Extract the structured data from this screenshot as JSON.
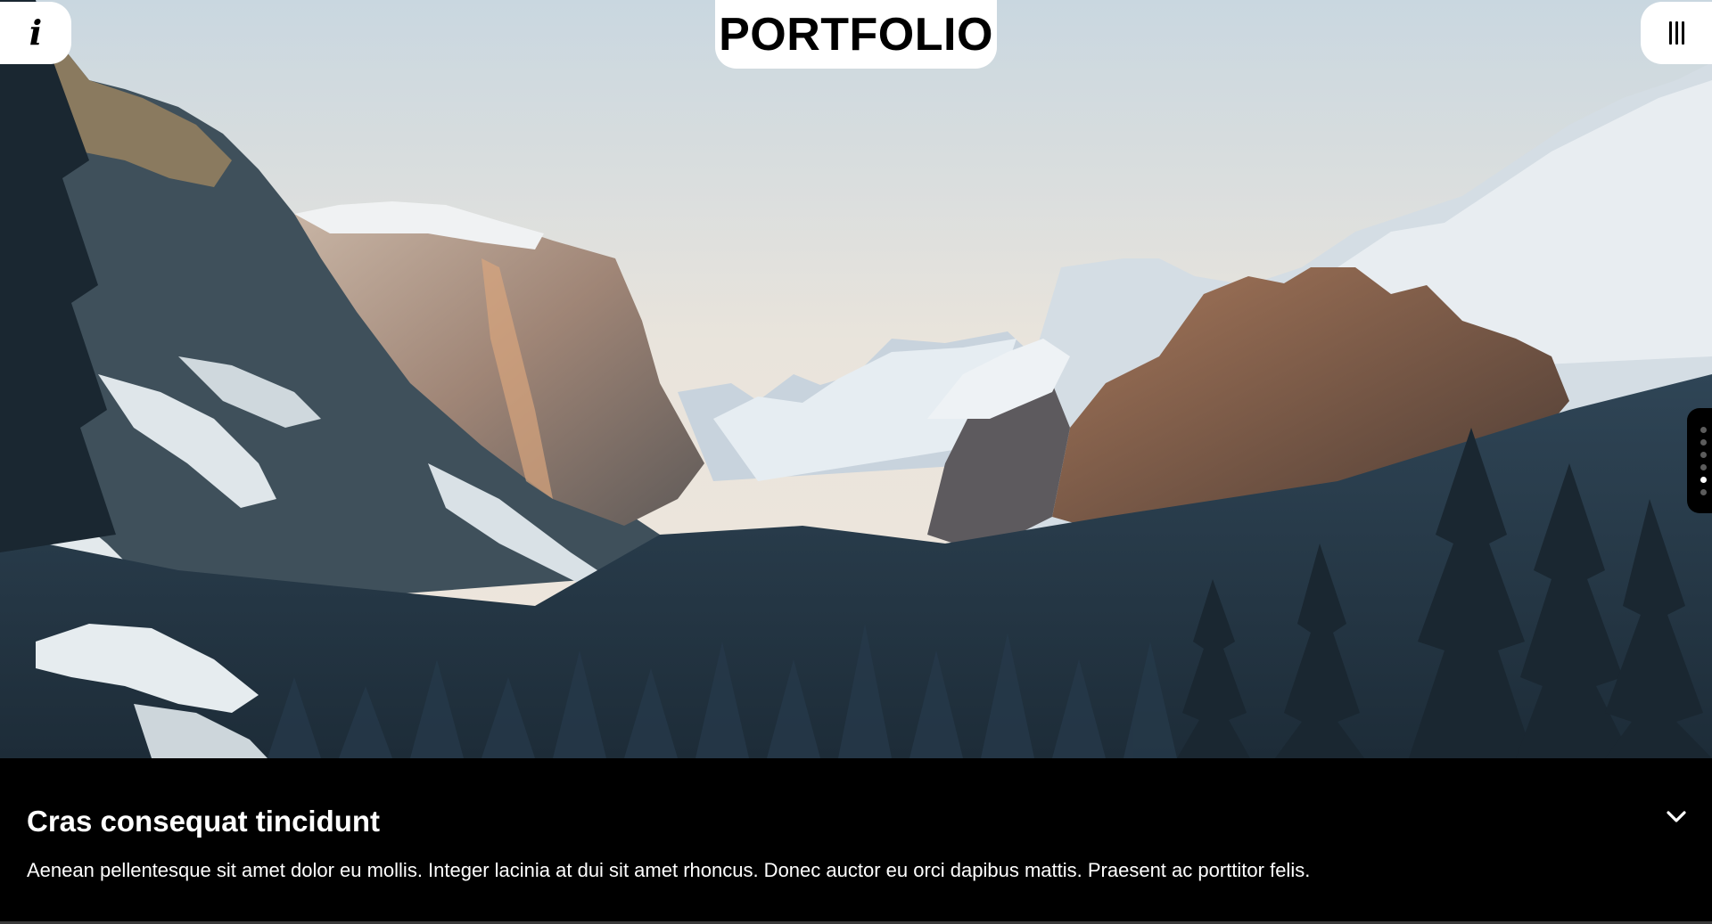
{
  "header": {
    "logo_text": "PORTFOLIO",
    "info_icon": "info-icon",
    "info_glyph": "i",
    "menu_icon": "menu-bars-icon"
  },
  "slider": {
    "total_slides": 6,
    "active_slide": 5
  },
  "caption": {
    "title": "Cras consequat tincidunt",
    "body": "Aenean pellentesque sit amet dolor eu mollis. Integer lacinia at dui sit amet rhoncus. Donec auctor eu orci dapibus mattis. Praesent ac porttitor felis.",
    "toggle_icon": "chevron-down-icon"
  },
  "colors": {
    "background": "#000000",
    "panel": "#ffffff",
    "text_light": "#ffffff",
    "text_dark": "#000000"
  }
}
